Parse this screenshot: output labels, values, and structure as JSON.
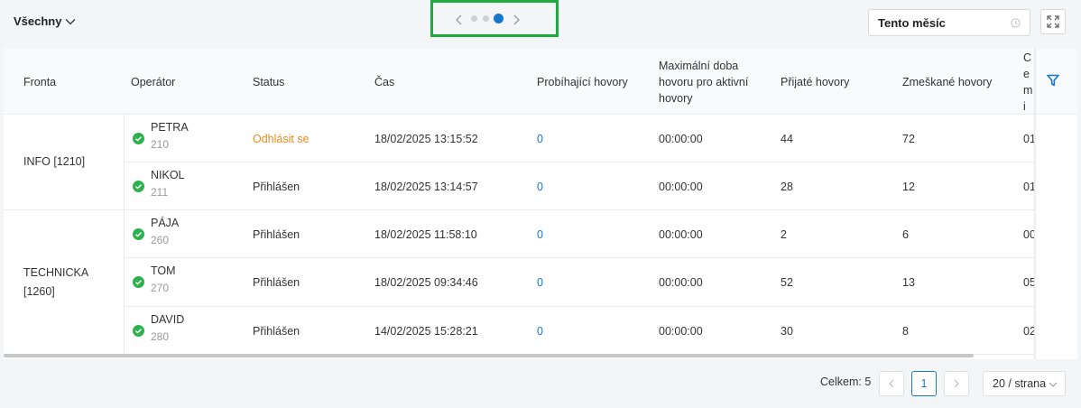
{
  "toolbar": {
    "filter_label": "Všechny",
    "period_label": "Tento měsíc"
  },
  "carousel": {
    "pages": 3,
    "active_index": 2
  },
  "table": {
    "columns": {
      "queue": "Fronta",
      "operator": "Operátor",
      "status": "Status",
      "time": "Čas",
      "ongoing": "Probíhající hovory",
      "maxdur": "Maximální doba hovoru pro aktivní hovory",
      "accepted": "Přijaté hovory",
      "missed": "Zmeškané hovory",
      "cut": "Ce mi"
    },
    "queues": [
      "INFO [1210]",
      "TECHNICKA [1260]"
    ],
    "rows": [
      {
        "name": "PETRA",
        "ext": "210",
        "status": "Odhlásit se",
        "time": "18/02/2025 13:15:52",
        "ongoing": "0",
        "maxdur": "00:00:00",
        "accepted": "44",
        "missed": "72",
        "cut": "01"
      },
      {
        "name": "NIKOL",
        "ext": "211",
        "status": "Přihlášen",
        "time": "18/02/2025 13:14:57",
        "ongoing": "0",
        "maxdur": "00:00:00",
        "accepted": "28",
        "missed": "12",
        "cut": "01"
      },
      {
        "name": "PÁJA",
        "ext": "260",
        "status": "Přihlášen",
        "time": "18/02/2025 11:58:10",
        "ongoing": "0",
        "maxdur": "00:00:00",
        "accepted": "2",
        "missed": "6",
        "cut": "00"
      },
      {
        "name": "TOM",
        "ext": "270",
        "status": "Přihlášen",
        "time": "18/02/2025 09:34:46",
        "ongoing": "0",
        "maxdur": "00:00:00",
        "accepted": "52",
        "missed": "13",
        "cut": "05"
      },
      {
        "name": "DAVID",
        "ext": "280",
        "status": "Přihlášen",
        "time": "14/02/2025 15:28:21",
        "ongoing": "0",
        "maxdur": "00:00:00",
        "accepted": "30",
        "missed": "8",
        "cut": "02"
      }
    ]
  },
  "footer": {
    "total": "Celkem: 5",
    "current_page": "1",
    "page_size": "20 / strana"
  },
  "colors": {
    "accent": "#1677cc",
    "success": "#2bb24c",
    "warning": "#f08c1a",
    "highlight_box": "#1eaa3c"
  }
}
